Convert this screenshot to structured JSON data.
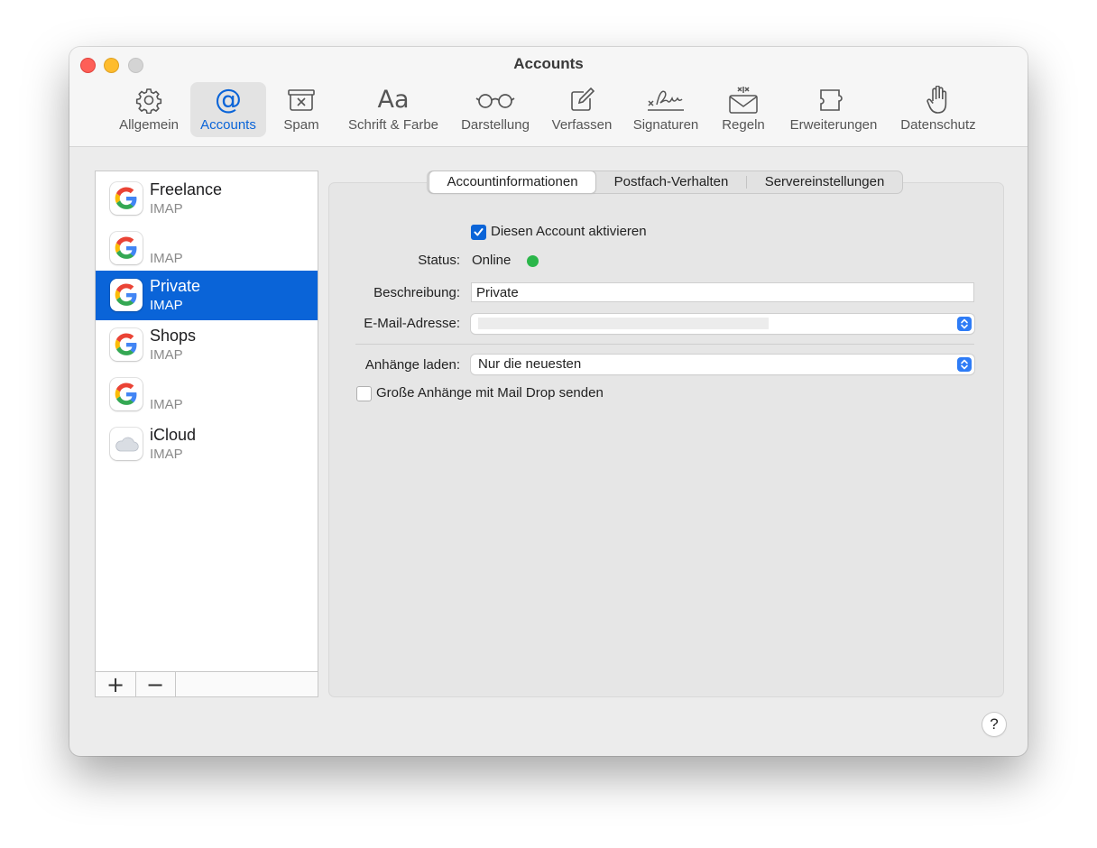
{
  "window": {
    "title": "Accounts"
  },
  "toolbar": {
    "items": [
      {
        "label": "Allgemein",
        "icon": "gear-icon"
      },
      {
        "label": "Accounts",
        "icon": "at-sign-icon",
        "selected": true
      },
      {
        "label": "Spam",
        "icon": "junk-tray-icon"
      },
      {
        "label": "Schrift & Farbe",
        "icon": "font-aa-icon"
      },
      {
        "label": "Darstellung",
        "icon": "glasses-icon"
      },
      {
        "label": "Verfassen",
        "icon": "compose-icon"
      },
      {
        "label": "Signaturen",
        "icon": "signature-icon"
      },
      {
        "label": "Regeln",
        "icon": "rules-envelope-icon"
      },
      {
        "label": "Erweiterungen",
        "icon": "puzzle-extension-icon"
      },
      {
        "label": "Datenschutz",
        "icon": "hand-privacy-icon"
      }
    ]
  },
  "accounts": [
    {
      "name": "Freelance",
      "type": "IMAP",
      "icon": "google-icon"
    },
    {
      "name": "",
      "type": "IMAP",
      "icon": "google-icon"
    },
    {
      "name": "Private",
      "type": "IMAP",
      "icon": "google-icon",
      "selected": true
    },
    {
      "name": "Shops",
      "type": "IMAP",
      "icon": "google-icon"
    },
    {
      "name": "",
      "type": "IMAP",
      "icon": "google-icon"
    },
    {
      "name": "iCloud",
      "type": "IMAP",
      "icon": "icloud-icon"
    }
  ],
  "sidebar": {
    "add_label": "+",
    "remove_label": "−"
  },
  "tabs": [
    {
      "label": "Accountinformationen",
      "active": true
    },
    {
      "label": "Postfach-Verhalten"
    },
    {
      "label": "Servereinstellungen"
    }
  ],
  "form": {
    "enable_account_label": "Diesen Account aktivieren",
    "enable_account_checked": true,
    "status_label": "Status:",
    "status_value": "Online",
    "description_label": "Beschreibung:",
    "description_value": "Private",
    "email_label": "E-Mail-Adresse:",
    "attachments_label": "Anhänge laden:",
    "attachments_value": "Nur die neuesten",
    "maildrop_label": "Große Anhänge mit Mail Drop senden",
    "maildrop_checked": false
  },
  "help": {
    "label": "?"
  },
  "colors": {
    "accent": "#0a64d8",
    "status_online": "#2bb64a",
    "close": "#fe5f57",
    "minimize": "#febc2e",
    "zoom": "#d4d4d4"
  }
}
